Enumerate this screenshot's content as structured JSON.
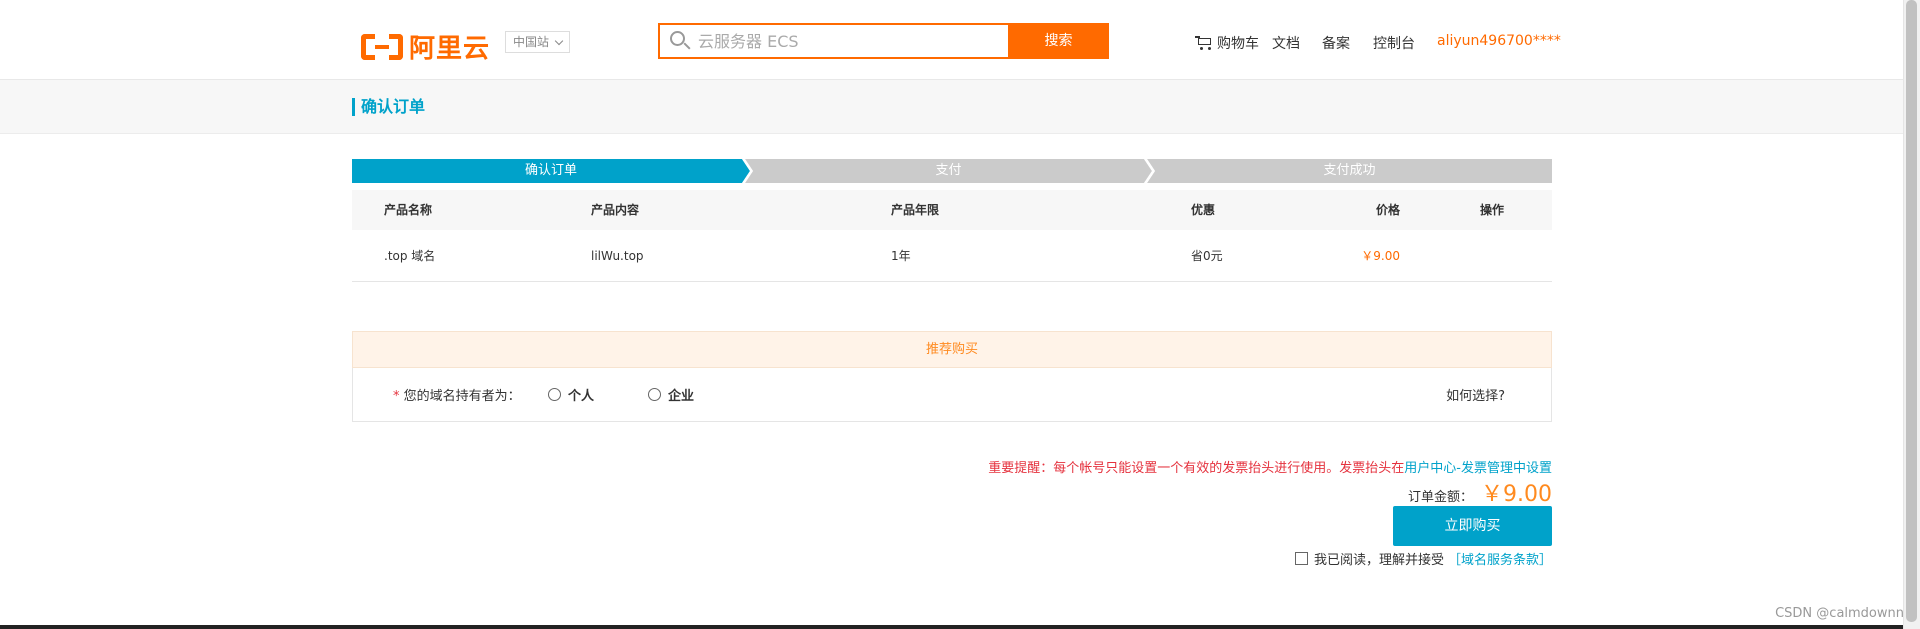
{
  "header": {
    "logo_text": "阿里云",
    "region": "中国站",
    "search_placeholder": "云服务器 ECS",
    "search_button": "搜索",
    "nav": {
      "cart": "购物车",
      "docs": "文档",
      "beian": "备案",
      "console": "控制台",
      "user": "aliyun496700****"
    }
  },
  "page_title": "确认订单",
  "steps": [
    "确认订单",
    "支付",
    "支付成功"
  ],
  "table": {
    "headers": [
      "产品名称",
      "产品内容",
      "产品年限",
      "优惠",
      "价格",
      "操作"
    ],
    "rows": [
      {
        "name": ".top 域名",
        "content": "lilWu.top",
        "term": "1年",
        "discount": "省0元",
        "price": "￥9.00",
        "action": ""
      }
    ]
  },
  "recommend": {
    "title": "推荐购买",
    "owner_label": "您的域名持有者为：",
    "required_mark": "*",
    "options": [
      "个人",
      "企业"
    ],
    "how_to_choose": "如何选择?"
  },
  "footer": {
    "notice": "重要提醒：每个帐号只能设置一个有效的发票抬头进行使用。发票抬头在",
    "notice_link": "用户中心-发票管理中设置",
    "total_label": "订单金额：",
    "total_amount": "￥9.00",
    "buy_button": "立即购买",
    "agree_text": "我已阅读，理解并接受",
    "agree_link": "［域名服务条款］"
  },
  "watermark": "CSDN @calmdownn",
  "colors": {
    "brand_orange": "#ff6a00",
    "accent_blue": "#00a2ca",
    "warning_red": "#e5323e"
  }
}
